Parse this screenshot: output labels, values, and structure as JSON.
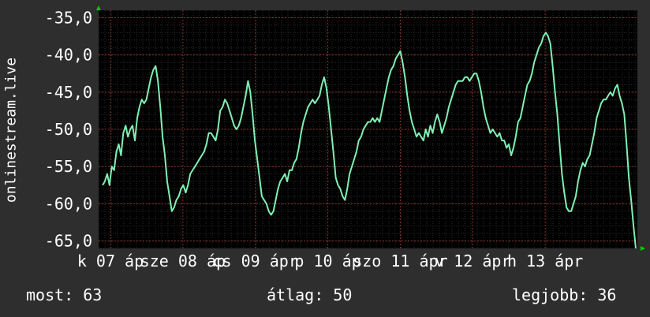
{
  "chart_data": {
    "type": "line",
    "ylabel": "onlinestream.live",
    "ylim": [
      -66,
      -34
    ],
    "yticks": [
      "-35,0",
      "-40,0",
      "-45,0",
      "-50,0",
      "-55,0",
      "-60,0",
      "-65,0"
    ],
    "ytick_values": [
      -35,
      -40,
      -45,
      -50,
      -55,
      -60,
      -65
    ],
    "xtick_labels": [
      "k 07 áp",
      "sze 08 áp",
      "cs 09 ápr",
      "p 10 áp",
      "szo 11 ápr",
      "v 12 ápr",
      "h 13 ápr"
    ],
    "line_color": "#7ff0b4",
    "grid": true,
    "series": [
      {
        "values": [
          -57.5,
          -57,
          -56,
          -57.5,
          -55,
          -55.5,
          -53,
          -52,
          -53.5,
          -50.5,
          -49.5,
          -51,
          -50,
          -49.5,
          -51.5,
          -48.5,
          -47,
          -46,
          -46.5,
          -46,
          -44.5,
          -43,
          -42,
          -41.5,
          -43.5,
          -47,
          -51,
          -53.5,
          -57,
          -59,
          -61,
          -60.5,
          -59.5,
          -59,
          -58,
          -57.5,
          -58.5,
          -57.5,
          -56,
          -55.5,
          -55,
          -54.5,
          -54,
          -53.5,
          -53,
          -52,
          -50.5,
          -50.5,
          -51,
          -51.5,
          -50,
          -47.5,
          -47,
          -46,
          -46.5,
          -47.5,
          -48.5,
          -49.5,
          -50,
          -49.5,
          -48.5,
          -47,
          -45.5,
          -43.5,
          -45,
          -48,
          -51.5,
          -54,
          -56.5,
          -59,
          -59.5,
          -60,
          -61,
          -61.5,
          -61,
          -59.5,
          -58,
          -57,
          -56.5,
          -56,
          -57,
          -55.5,
          -55.5,
          -54.5,
          -54,
          -52.5,
          -50.5,
          -49,
          -48,
          -47,
          -46.5,
          -46,
          -46.5,
          -46,
          -45.5,
          -44,
          -43,
          -44.5,
          -47,
          -50,
          -53,
          -56.5,
          -57.5,
          -58,
          -59,
          -59.5,
          -58,
          -56,
          -55,
          -54,
          -53,
          -51.5,
          -51,
          -50,
          -49.5,
          -49,
          -49,
          -48.5,
          -49,
          -48.5,
          -49,
          -47.5,
          -46,
          -44.5,
          -43,
          -42,
          -41.5,
          -40.5,
          -40,
          -39.5,
          -41,
          -43,
          -45.5,
          -47.5,
          -49,
          -50,
          -51,
          -50.5,
          -51,
          -51.5,
          -50,
          -51,
          -49.5,
          -50.5,
          -49,
          -48,
          -49,
          -50.5,
          -49.5,
          -48.5,
          -47,
          -46,
          -45,
          -44,
          -43.5,
          -43.5,
          -43.5,
          -43,
          -43,
          -43.5,
          -43,
          -42.5,
          -42.5,
          -43.5,
          -45,
          -47,
          -48.5,
          -49.5,
          -50.5,
          -50,
          -50.5,
          -51,
          -50.5,
          -51.5,
          -51.5,
          -52.5,
          -52,
          -53.5,
          -52.5,
          -51,
          -49,
          -48.5,
          -47,
          -45.5,
          -44,
          -43.5,
          -42.5,
          -41,
          -40,
          -39,
          -38.5,
          -37.5,
          -37,
          -37.5,
          -38.5,
          -41.5,
          -45,
          -48,
          -52,
          -56,
          -58.5,
          -60.5,
          -61,
          -61,
          -60,
          -59,
          -57,
          -55.5,
          -54.5,
          -55,
          -54,
          -53.5,
          -52,
          -50.5,
          -48.5,
          -47.5,
          -46.5,
          -46,
          -46,
          -45.5,
          -45,
          -45.5,
          -44.5,
          -44,
          -45.5,
          -46.5,
          -48,
          -52,
          -56.5,
          -59.5,
          -63,
          -66
        ]
      }
    ]
  },
  "footer": {
    "current": "most: 63",
    "average": "átlag: 50",
    "best": "legjobb: 36"
  }
}
